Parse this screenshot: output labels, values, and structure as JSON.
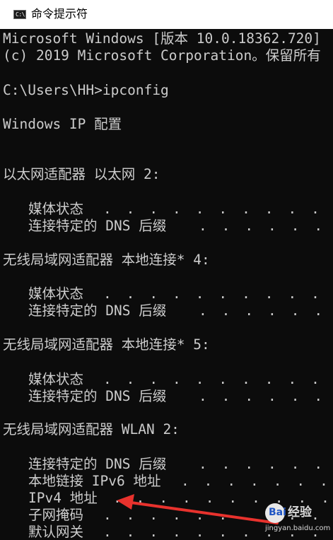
{
  "window": {
    "title": "命令提示符",
    "icon": "cmd-icon",
    "icon_text": "C:\\."
  },
  "console": {
    "banner_line1": "Microsoft Windows [版本 10.0.18362.720]",
    "banner_line2": "(c) 2019 Microsoft Corporation。保留所有",
    "prompt_command": "C:\\Users\\HH>ipconfig",
    "heading": "Windows IP 配置",
    "adapters": [
      {
        "title": "以太网适配器 以太网 2:",
        "fields": [
          {
            "label": "媒体状态",
            "dots": ". . . . . . . . . . . ."
          },
          {
            "label": "连接特定的 DNS 后缀",
            "dots": ". . . . . . . ."
          }
        ]
      },
      {
        "title": "无线局域网适配器 本地连接* 4:",
        "fields": [
          {
            "label": "媒体状态",
            "dots": ". . . . . . . . . . . ."
          },
          {
            "label": "连接特定的 DNS 后缀",
            "dots": ". . . . . . . ."
          }
        ]
      },
      {
        "title": "无线局域网适配器 本地连接* 5:",
        "fields": [
          {
            "label": "媒体状态",
            "dots": ". . . . . . . . . . . ."
          },
          {
            "label": "连接特定的 DNS 后缀",
            "dots": ". . . . . . . ."
          }
        ]
      },
      {
        "title": "无线局域网适配器 WLAN 2:",
        "fields": [
          {
            "label": "连接特定的 DNS 后缀",
            "dots": ". . . . . . . ."
          },
          {
            "label": "本地链接 IPv6 地址",
            "dots": ". . . . . . . ."
          },
          {
            "label": "IPv4 地址",
            "dots": ". . . . . . . . . . . ."
          },
          {
            "label": "子网掩码",
            "dots": ". . . . . . . . . . . ."
          },
          {
            "label": "默认网关",
            "dots": ". . . . . . . . . . . ."
          }
        ]
      }
    ]
  },
  "annotation": {
    "arrow_color": "#e8322d",
    "points_to": "IPv4 地址"
  },
  "watermark": {
    "brand": "Bai",
    "text": "经验",
    "url": "jingyan.baidu.com"
  }
}
